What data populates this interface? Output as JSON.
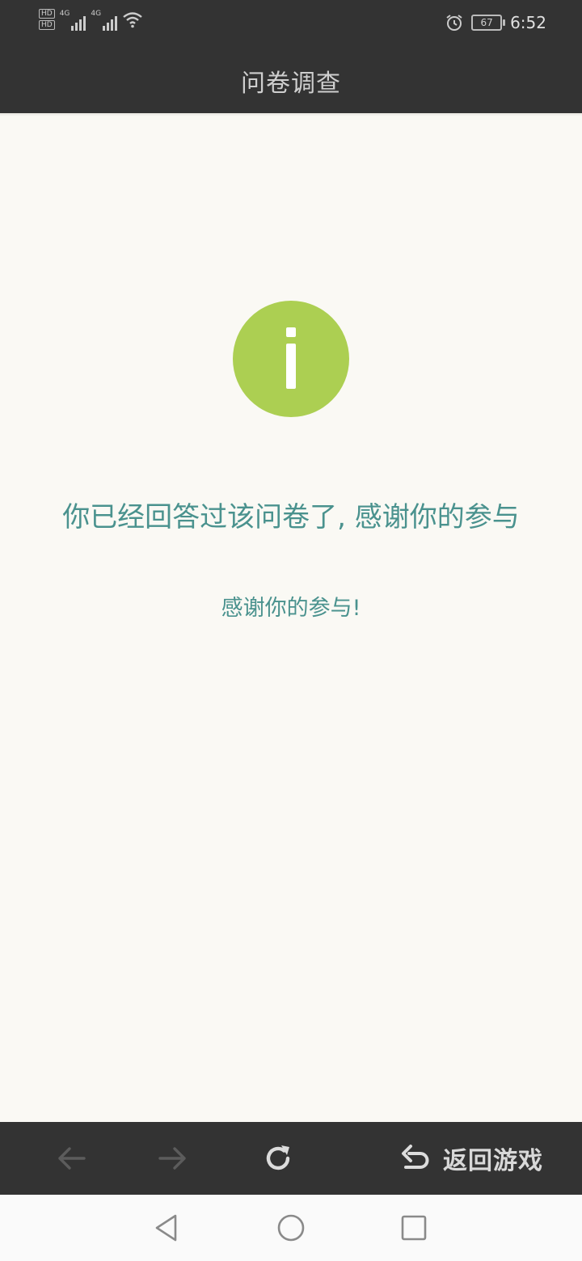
{
  "status_bar": {
    "hd_badges": [
      "HD",
      "HD"
    ],
    "signal_labels": [
      "4G",
      "4G"
    ],
    "battery": "67",
    "time": "6:52",
    "icons": [
      "hd-icon",
      "signal-icon",
      "wifi-icon",
      "alarm-icon",
      "battery-icon"
    ]
  },
  "app_bar": {
    "title": "问卷调查"
  },
  "content": {
    "icon": "info-icon",
    "icon_color": "#accf52",
    "message": "你已经回答过该问卷了, 感谢你的参与",
    "sub_message": "感谢你的参与!"
  },
  "toolbar": {
    "back_icon": "arrow-left-icon",
    "forward_icon": "arrow-right-icon",
    "reload_icon": "refresh-icon",
    "return_icon": "undo-icon",
    "return_label": "返回游戏"
  },
  "nav_bar": {
    "icons": [
      "nav-back-icon",
      "nav-home-icon",
      "nav-recents-icon"
    ]
  },
  "colors": {
    "bar_bg": "#333333",
    "text_accent": "#4a928e",
    "page_bg": "#faf9f4"
  }
}
